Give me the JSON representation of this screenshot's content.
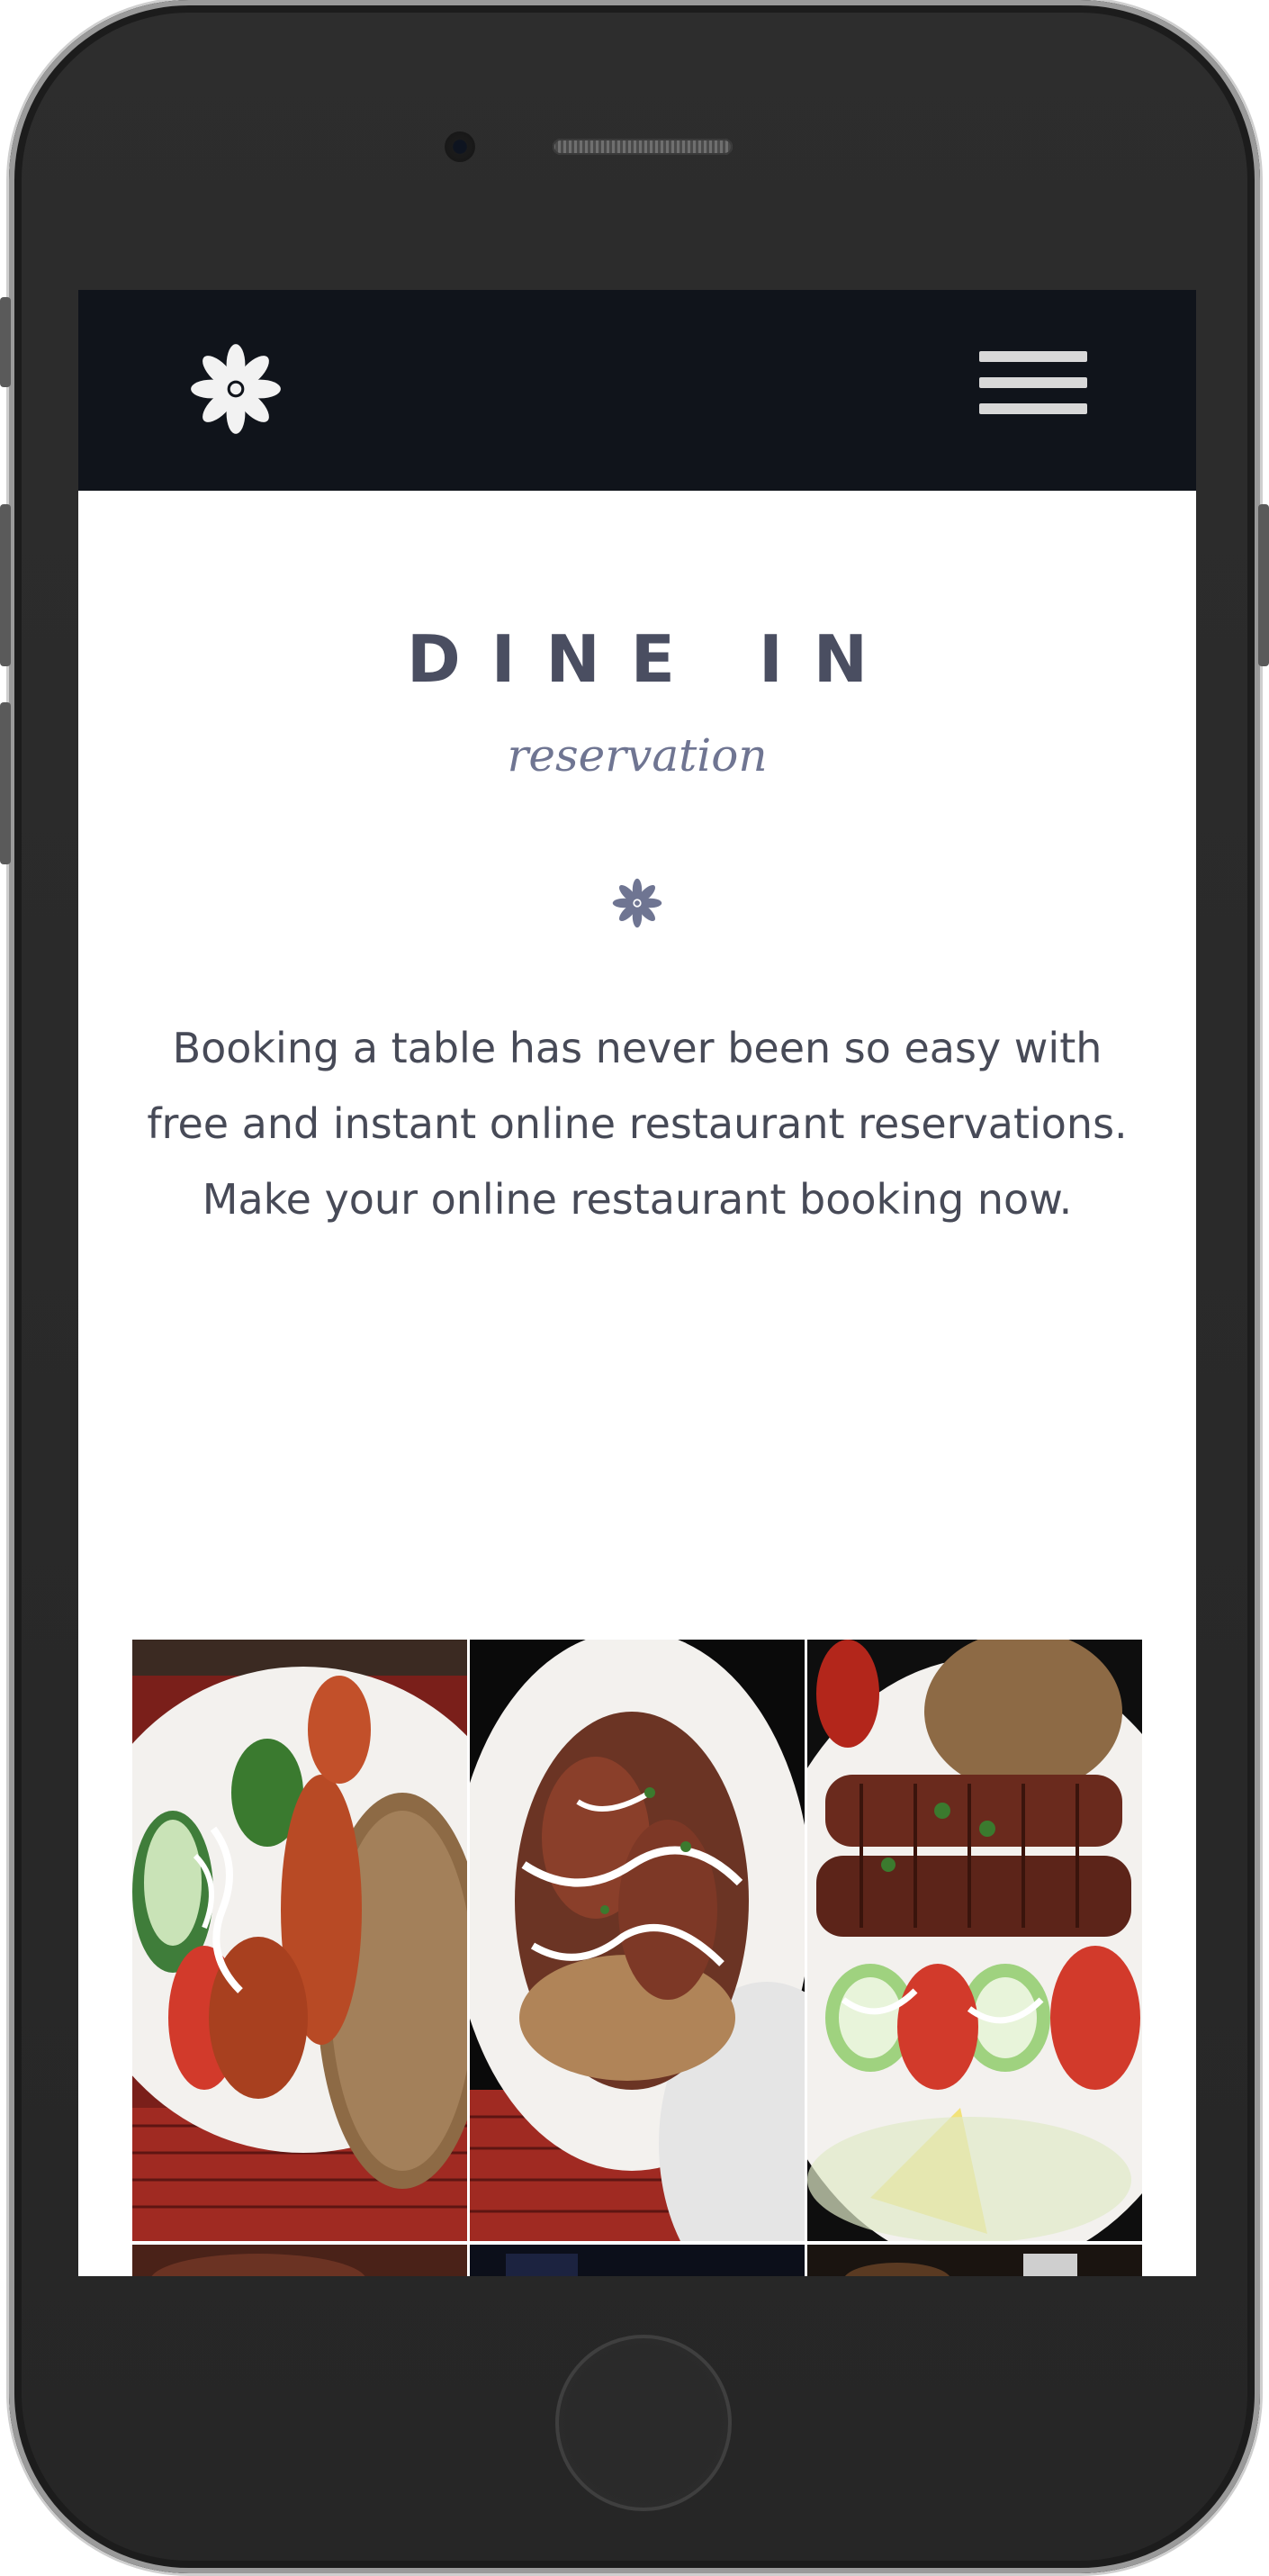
{
  "navbar": {
    "logo_icon": "asterisk-flower-icon",
    "menu_icon": "hamburger-menu-icon",
    "background": "#10141b"
  },
  "hero": {
    "title": "DINE IN",
    "subtitle": "reservation",
    "divider_icon": "asterisk-flower-icon",
    "description": "Booking a table has never been so easy with free and instant online restaurant reservations. Make your online restaurant booking now."
  },
  "colors": {
    "title": "#4a4e61",
    "subtitle": "#6f7592",
    "text": "#474a57"
  },
  "gallery": {
    "images": [
      "food-photo-chicken-kebab-rice",
      "food-photo-dumplings-yogurt",
      "food-photo-kofta-kebab-salad",
      "food-photo-partial-1",
      "food-photo-partial-2",
      "food-photo-partial-3"
    ]
  }
}
